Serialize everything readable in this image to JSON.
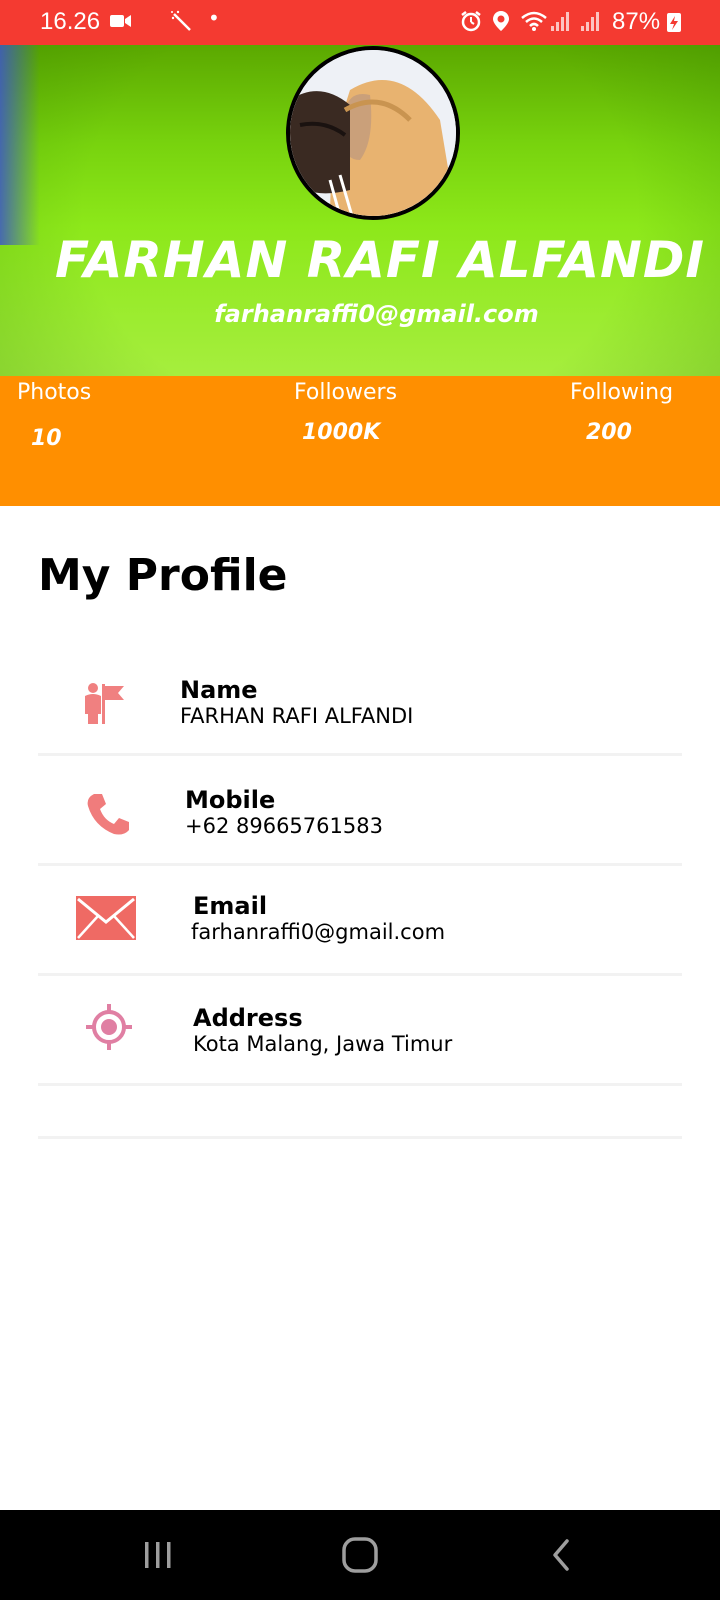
{
  "status_bar": {
    "time": "16.26",
    "battery": "87%",
    "icons": [
      "video-icon",
      "magic-wand-icon",
      "dot-icon",
      "alarm-icon",
      "location-icon",
      "wifi-icon",
      "signal-icon",
      "signal-icon",
      "battery-charging-icon"
    ]
  },
  "header": {
    "name": "FARHAN RAFI ALFANDI",
    "email": "farhanraffi0@gmail.com",
    "colors": {
      "green_top": "#5ba800",
      "green_bottom": "#a6ee3e"
    }
  },
  "stats": {
    "background": "#ff8f00",
    "items": [
      {
        "label": "Photos",
        "value": "10"
      },
      {
        "label": "Followers",
        "value": "1000K"
      },
      {
        "label": "Following",
        "value": "200"
      }
    ]
  },
  "profile": {
    "title": "My Profile",
    "rows": [
      {
        "label": "Name",
        "value": "FARHAN RAFI ALFANDI",
        "icon": "person-flag-icon"
      },
      {
        "label": "Mobile",
        "value": "+62 89665761583",
        "icon": "phone-icon"
      },
      {
        "label": "Email",
        "value": "farhanraffi0@gmail.com",
        "icon": "envelope-icon"
      },
      {
        "label": "Address",
        "value": "Kota Malang, Jawa Timur",
        "icon": "location-target-icon"
      }
    ]
  },
  "nav_bar": {
    "buttons": [
      "recent-apps-icon",
      "home-icon",
      "back-icon"
    ]
  }
}
